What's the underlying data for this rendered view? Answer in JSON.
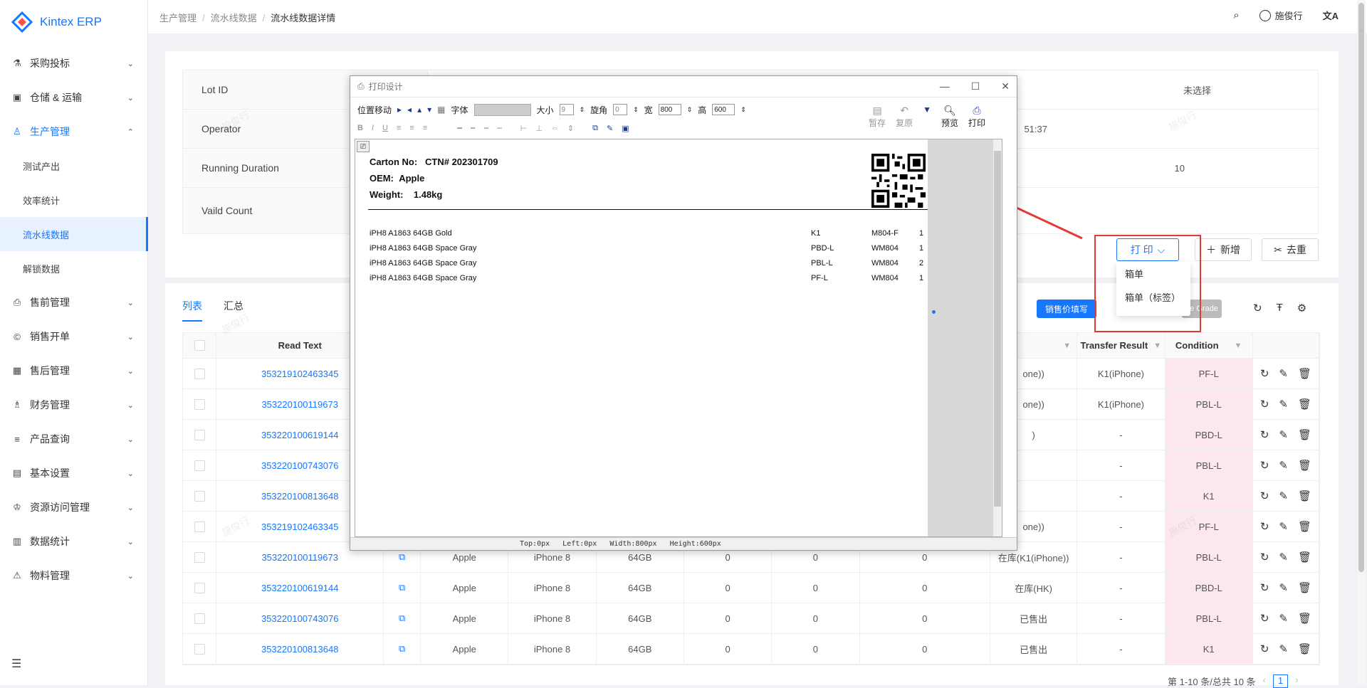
{
  "app": {
    "name": "Kintex ERP"
  },
  "sidebar": {
    "items": [
      {
        "label": "采购投标",
        "icon": "flask-icon"
      },
      {
        "label": "仓储 & 运输",
        "icon": "box-icon"
      },
      {
        "label": "生产管理",
        "icon": "factory-icon",
        "open": true
      },
      {
        "label": "售前管理",
        "icon": "printer-icon"
      },
      {
        "label": "销售开单",
        "icon": "copyright-icon"
      },
      {
        "label": "售后管理",
        "icon": "grid-icon"
      },
      {
        "label": "财务管理",
        "icon": "org-icon"
      },
      {
        "label": "产品查询",
        "icon": "list-icon"
      },
      {
        "label": "基本设置",
        "icon": "doc-icon"
      },
      {
        "label": "资源访问管理",
        "icon": "user-key-icon"
      },
      {
        "label": "数据统计",
        "icon": "bar-chart-icon"
      },
      {
        "label": "物料管理",
        "icon": "warning-icon"
      }
    ],
    "sub_items": [
      "测试产出",
      "效率统计",
      "流水线数据",
      "解锁数据"
    ],
    "active_sub": "流水线数据"
  },
  "breadcrumb": [
    "生产管理",
    "流水线数据",
    "流水线数据详情"
  ],
  "header": {
    "user": "施俊行"
  },
  "info": {
    "rows": [
      {
        "label": "Lot ID",
        "right_value": "未选择"
      },
      {
        "label": "Operator",
        "mid_value": "51:37"
      },
      {
        "label": "Running Duration",
        "right_value": "10"
      },
      {
        "label": "Vaild Count"
      }
    ]
  },
  "actions": {
    "print": "打 印",
    "add": "新增",
    "dedupe": "去重"
  },
  "print_menu": [
    "箱单",
    "箱单（标签）"
  ],
  "tabs": [
    "列表",
    "汇总"
  ],
  "toolbar2": {
    "sales_fill": "销售价填写",
    "grade": "de Grade"
  },
  "table": {
    "headers": {
      "read_text": "Read Text",
      "transfer_result": "Transfer Result",
      "condition": "Condition"
    },
    "rows": [
      {
        "read": "353219102463345",
        "brand": "",
        "model": "",
        "storage": "",
        "a": "",
        "b": "",
        "c": "",
        "status": "one))",
        "transfer": "K1(iPhone)",
        "cond": "PF-L"
      },
      {
        "read": "353220100119673",
        "brand": "",
        "model": "",
        "storage": "",
        "a": "",
        "b": "",
        "c": "",
        "status": "one))",
        "transfer": "K1(iPhone)",
        "cond": "PBL-L"
      },
      {
        "read": "353220100619144",
        "brand": "",
        "model": "",
        "storage": "",
        "a": "",
        "b": "",
        "c": "",
        "status": ")",
        "transfer": "-",
        "cond": "PBD-L"
      },
      {
        "read": "353220100743076",
        "brand": "",
        "model": "",
        "storage": "",
        "a": "",
        "b": "",
        "c": "",
        "status": "",
        "transfer": "-",
        "cond": "PBL-L"
      },
      {
        "read": "353220100813648",
        "brand": "",
        "model": "",
        "storage": "",
        "a": "",
        "b": "",
        "c": "",
        "status": "",
        "transfer": "-",
        "cond": "K1"
      },
      {
        "read": "353219102463345",
        "brand": "",
        "model": "",
        "storage": "",
        "a": "",
        "b": "",
        "c": "",
        "status": "one))",
        "transfer": "-",
        "cond": "PF-L"
      },
      {
        "read": "353220100119673",
        "brand": "Apple",
        "model": "iPhone 8",
        "storage": "64GB",
        "a": "0",
        "b": "0",
        "c": "0",
        "status": "在库(K1(iPhone))",
        "transfer": "-",
        "cond": "PBL-L"
      },
      {
        "read": "353220100619144",
        "brand": "Apple",
        "model": "iPhone 8",
        "storage": "64GB",
        "a": "0",
        "b": "0",
        "c": "0",
        "status": "在库(HK)",
        "transfer": "-",
        "cond": "PBD-L"
      },
      {
        "read": "353220100743076",
        "brand": "Apple",
        "model": "iPhone 8",
        "storage": "64GB",
        "a": "0",
        "b": "0",
        "c": "0",
        "status": "已售出",
        "transfer": "-",
        "cond": "PBL-L"
      },
      {
        "read": "353220100813648",
        "brand": "Apple",
        "model": "iPhone 8",
        "storage": "64GB",
        "a": "0",
        "b": "0",
        "c": "0",
        "status": "已售出",
        "transfer": "-",
        "cond": "K1"
      }
    ]
  },
  "pagination": {
    "summary": "第 1-10 条/总共 10 条",
    "page": "1"
  },
  "watermark": "施俊行",
  "print_dialog": {
    "title": "打印设计",
    "toolbar": {
      "move": "位置移动",
      "font": "字体",
      "size": "大小",
      "size_val": "9",
      "rotate": "旋角",
      "rotate_val": "0",
      "width": "宽",
      "width_val": "800",
      "height": "高",
      "height_val": "600",
      "save": "暂存",
      "restore": "复原",
      "preview": "预览",
      "print": "打印"
    },
    "label": {
      "carton_key": "Carton No:",
      "carton_val": "CTN# 202301709",
      "oem_key": "OEM:",
      "oem_val": "Apple",
      "weight_key": "Weight:",
      "weight_val": "1.48kg"
    },
    "lines": [
      {
        "desc": "iPH8  A1863  64GB  Gold",
        "grade": "K1",
        "code": "M804-F",
        "qty": "1"
      },
      {
        "desc": "iPH8  A1863  64GB  Space Gray",
        "grade": "PBD-L",
        "code": "WM804",
        "qty": "1"
      },
      {
        "desc": "iPH8  A1863  64GB  Space Gray",
        "grade": "PBL-L",
        "code": "WM804",
        "qty": "2"
      },
      {
        "desc": "iPH8  A1863  64GB  Space Gray",
        "grade": "PF-L",
        "code": "WM804",
        "qty": "1"
      }
    ],
    "status": {
      "top": "Top:0px",
      "left": "Left:0px",
      "width": "Width:800px",
      "height": "Height:600px"
    }
  }
}
